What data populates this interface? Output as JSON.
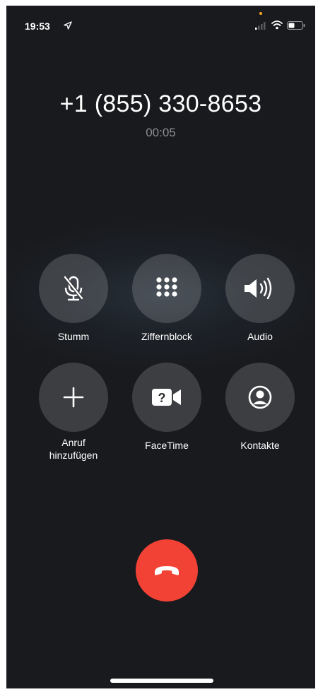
{
  "status_bar": {
    "time": "19:53",
    "icons": [
      "location-arrow-icon",
      "signal-icon",
      "wifi-icon",
      "battery-icon"
    ],
    "mic_indicator_color": "#f5a623"
  },
  "call": {
    "number": "+1 (855) 330-8653",
    "duration": "00:05"
  },
  "controls": [
    {
      "label": "Stumm",
      "icon": "mic-off-icon"
    },
    {
      "label": "Ziffernblock",
      "icon": "keypad-icon"
    },
    {
      "label": "Audio",
      "icon": "speaker-icon"
    },
    {
      "label": "Anruf\nhinzufügen",
      "icon": "plus-icon"
    },
    {
      "label": "FaceTime",
      "icon": "facetime-icon"
    },
    {
      "label": "Kontakte",
      "icon": "contact-icon"
    }
  ],
  "end_call": {
    "icon": "end-call-icon",
    "color": "#f24236"
  }
}
